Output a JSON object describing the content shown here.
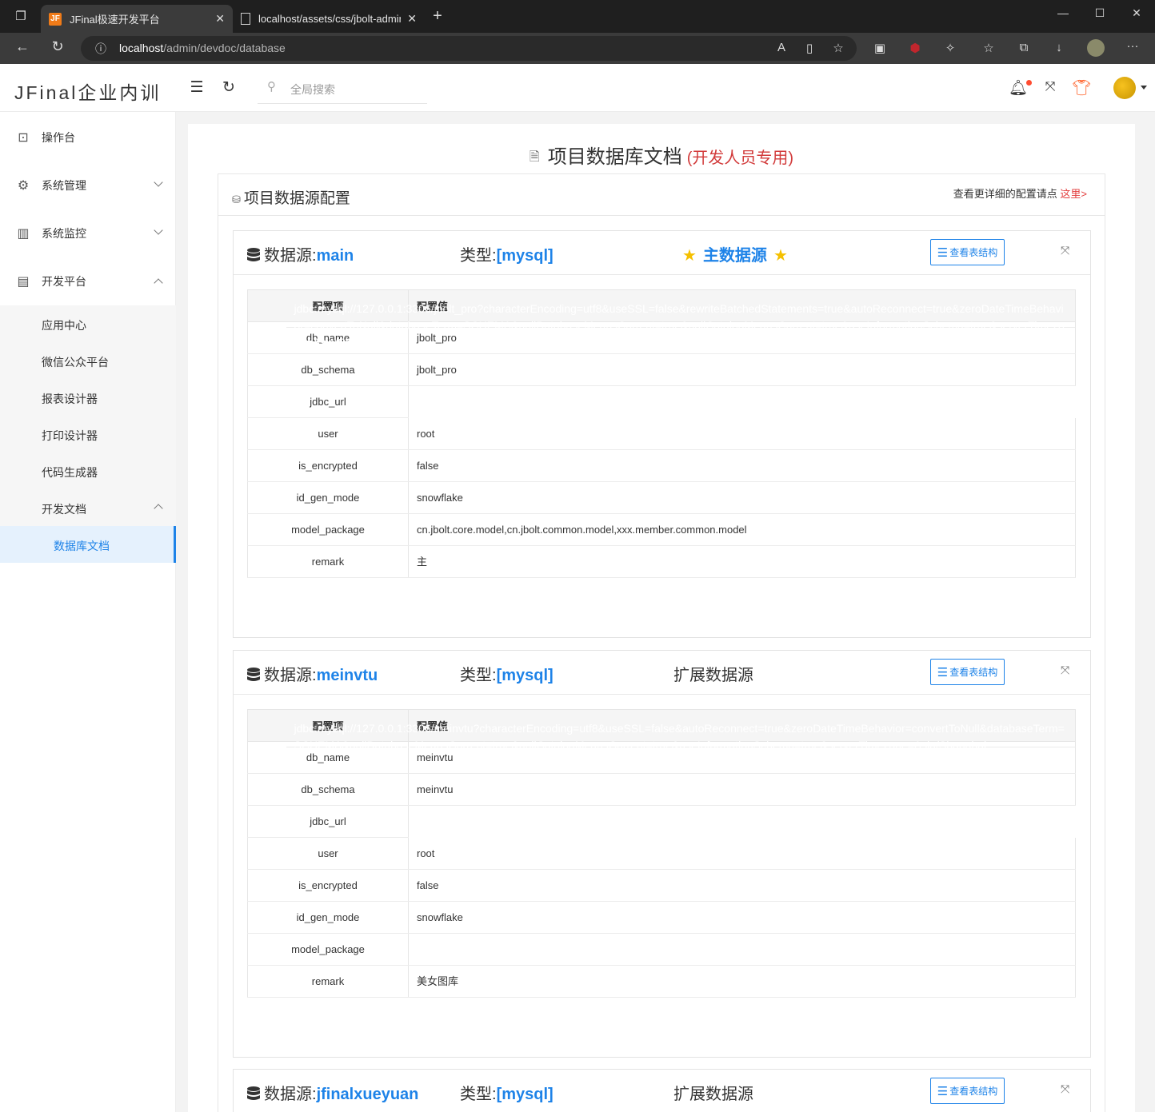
{
  "browser": {
    "tabs": [
      {
        "label": "JFinal极速开发平台",
        "favicon": "JF",
        "active": true
      },
      {
        "label": "localhost/assets/css/jbolt-admin",
        "favicon": "page-icon",
        "active": false
      }
    ],
    "url_host": "localhost",
    "url_path": "/admin/devdoc/database"
  },
  "header": {
    "logo": "JFinal企业内训",
    "search_placeholder": "全局搜索"
  },
  "sidebar": {
    "items": [
      {
        "label": "操作台",
        "icon": "chart-icon"
      },
      {
        "label": "系统管理",
        "icon": "gear-icon"
      },
      {
        "label": "系统监控",
        "icon": "monitor-icon"
      },
      {
        "label": "开发平台",
        "icon": "dev-icon"
      }
    ],
    "sub_items": [
      {
        "label": "应用中心"
      },
      {
        "label": "微信公众平台"
      },
      {
        "label": "报表设计器"
      },
      {
        "label": "打印设计器"
      },
      {
        "label": "代码生成器"
      },
      {
        "label": "开发文档"
      },
      {
        "label": "数据库文档"
      }
    ]
  },
  "page": {
    "title": "项目数据库文档",
    "title_note": "(开发人员专用)",
    "config_title": "项目数据源配置",
    "config_link_text": "查看更详细的配置请点",
    "config_link": "这里>"
  },
  "labels": {
    "ds_prefix": "数据源:",
    "type_prefix": "类型:",
    "struct_button": "查看表结构",
    "col_key": "配置项",
    "col_value": "配置值"
  },
  "datasources": [
    {
      "name": "main",
      "type": "[mysql]",
      "role": "主数据源",
      "rows": [
        {
          "k": "db_name",
          "v": "jbolt_pro"
        },
        {
          "k": "db_schema",
          "v": "jbolt_pro"
        },
        {
          "k": "jdbc_url",
          "v": "jdbc:mysql://127.0.0.1:3306/jbolt_pro?characterEncoding=utf8&useSSL=false&rewriteBatchedStatements=true&autoReconnect=true&zeroDateTimeBehavior=convertToNull&databaseTerm=SCHEMA&nullDatabaseMeansCurrent=true&nullCatalogMeansCurrent=true&useInformationSchema=true&serverTimezone=Asia/Shanghai"
        },
        {
          "k": "user",
          "v": "root"
        },
        {
          "k": "is_encrypted",
          "v": "false"
        },
        {
          "k": "id_gen_mode",
          "v": "snowflake"
        },
        {
          "k": "model_package",
          "v": "cn.jbolt.core.model,cn.jbolt.common.model,xxx.member.common.model"
        },
        {
          "k": "remark",
          "v": "主"
        }
      ]
    },
    {
      "name": "meinvtu",
      "type": "[mysql]",
      "role": "扩展数据源",
      "rows": [
        {
          "k": "db_name",
          "v": "meinvtu"
        },
        {
          "k": "db_schema",
          "v": "meinvtu"
        },
        {
          "k": "jdbc_url",
          "v": "jdbc:mysql://127.0.0.1:3306/meinvtu?characterEncoding=utf8&useSSL=false&autoReconnect=true&zeroDateTimeBehavior=convertToNull&databaseTerm=SCHEMA&nullDatabaseMeansCurrent=true&nullCatalogMeansCurrent=true&useInformationSchema=true&serverTimezone=Asia/Shanghai"
        },
        {
          "k": "user",
          "v": "root"
        },
        {
          "k": "is_encrypted",
          "v": "false"
        },
        {
          "k": "id_gen_mode",
          "v": "snowflake"
        },
        {
          "k": "model_package",
          "v": ""
        },
        {
          "k": "remark",
          "v": "美女图库"
        }
      ]
    },
    {
      "name": "jfinalxueyuan",
      "type": "[mysql]",
      "role": "扩展数据源",
      "rows": []
    }
  ]
}
